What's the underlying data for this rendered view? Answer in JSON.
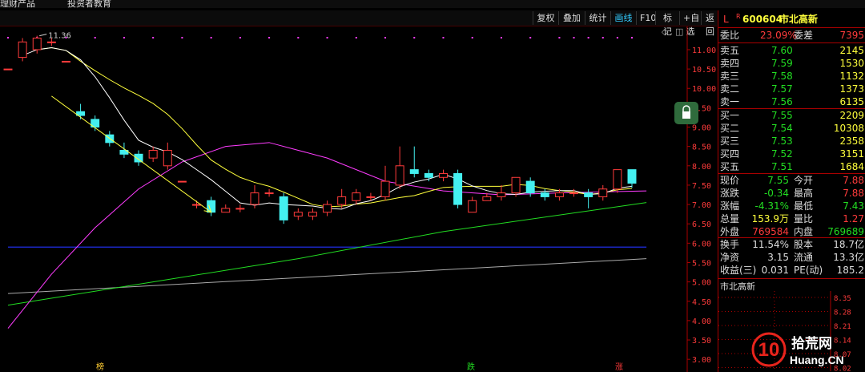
{
  "topbar": {
    "items": [
      "理财产品",
      "投资者教育"
    ]
  },
  "toolbar": {
    "buttons": [
      {
        "label": "复权",
        "active": false
      },
      {
        "label": "叠加",
        "active": false
      },
      {
        "label": "统计",
        "active": false
      },
      {
        "label": "画线",
        "active": true
      },
      {
        "label": "F10",
        "active": false
      },
      {
        "label": "标记",
        "active": false
      },
      {
        "label": "+自选",
        "active": false
      },
      {
        "label": "返回",
        "active": false
      }
    ]
  },
  "chart": {
    "peak_label": "11.36",
    "y_ticks": [
      "11.00",
      "10.50",
      "10.00",
      "9.50",
      "9.00",
      "8.50",
      "8.00",
      "7.50",
      "7.00",
      "6.50",
      "6.00",
      "5.50",
      "5.00",
      "4.50",
      "4.00",
      "3.50",
      "3.00"
    ],
    "bottom_markers": [
      {
        "label": "榜",
        "color": "#ffcc33"
      },
      {
        "label": "跌",
        "color": "#22dd22"
      },
      {
        "label": "涨",
        "color": "#ff3b3b"
      }
    ],
    "colors": {
      "up": "#ff3b3b",
      "down": "#44f0f0",
      "ma5": "#ffffff",
      "ma10": "#ffff3c",
      "ma20": "#ff3cff",
      "ma60": "#22dd22",
      "ma120": "#2233ff",
      "ma250": "#aaaaaa"
    }
  },
  "chart_data": {
    "type": "candlestick",
    "ylim": [
      2.9,
      11.6
    ],
    "candles": [
      {
        "o": 10.5,
        "c": 10.5,
        "h": 10.5,
        "l": 10.5
      },
      {
        "o": 10.8,
        "c": 11.2,
        "h": 11.3,
        "l": 10.7
      },
      {
        "o": 11.0,
        "c": 11.3,
        "h": 11.36,
        "l": 10.9
      },
      {
        "o": 11.2,
        "c": 11.2,
        "h": 11.3,
        "l": 11.1
      },
      {
        "o": 10.7,
        "c": 10.7,
        "h": 10.7,
        "l": 10.7
      },
      {
        "o": 9.4,
        "c": 9.3,
        "h": 9.6,
        "l": 9.2
      },
      {
        "o": 9.2,
        "c": 9.0,
        "h": 9.3,
        "l": 8.9
      },
      {
        "o": 8.8,
        "c": 8.6,
        "h": 8.9,
        "l": 8.5
      },
      {
        "o": 8.4,
        "c": 8.3,
        "h": 8.6,
        "l": 8.2
      },
      {
        "o": 8.3,
        "c": 8.1,
        "h": 8.4,
        "l": 8.0
      },
      {
        "o": 8.2,
        "c": 8.4,
        "h": 8.5,
        "l": 8.1
      },
      {
        "o": 8.0,
        "c": 8.4,
        "h": 8.6,
        "l": 7.9
      },
      {
        "o": 7.6,
        "c": 7.6,
        "h": 7.6,
        "l": 7.6
      },
      {
        "o": 7.0,
        "c": 7.0,
        "h": 7.1,
        "l": 6.9
      },
      {
        "o": 7.1,
        "c": 6.8,
        "h": 7.2,
        "l": 6.7
      },
      {
        "o": 6.8,
        "c": 6.9,
        "h": 7.0,
        "l": 6.8
      },
      {
        "o": 6.9,
        "c": 6.9,
        "h": 7.0,
        "l": 6.8
      },
      {
        "o": 7.0,
        "c": 7.3,
        "h": 7.5,
        "l": 6.9
      },
      {
        "o": 7.3,
        "c": 7.3,
        "h": 7.4,
        "l": 7.2
      },
      {
        "o": 7.2,
        "c": 6.6,
        "h": 7.3,
        "l": 6.5
      },
      {
        "o": 6.7,
        "c": 6.8,
        "h": 6.9,
        "l": 6.6
      },
      {
        "o": 6.7,
        "c": 6.8,
        "h": 6.9,
        "l": 6.6
      },
      {
        "o": 6.8,
        "c": 7.0,
        "h": 7.1,
        "l": 6.7
      },
      {
        "o": 7.0,
        "c": 7.2,
        "h": 7.4,
        "l": 6.9
      },
      {
        "o": 7.1,
        "c": 7.3,
        "h": 7.4,
        "l": 7.0
      },
      {
        "o": 7.2,
        "c": 7.2,
        "h": 7.3,
        "l": 7.1
      },
      {
        "o": 7.2,
        "c": 7.6,
        "h": 8.0,
        "l": 7.1
      },
      {
        "o": 7.5,
        "c": 8.0,
        "h": 8.5,
        "l": 7.4
      },
      {
        "o": 7.9,
        "c": 7.8,
        "h": 8.5,
        "l": 7.7
      },
      {
        "o": 7.8,
        "c": 7.7,
        "h": 7.9,
        "l": 7.6
      },
      {
        "o": 7.7,
        "c": 7.8,
        "h": 7.9,
        "l": 7.6
      },
      {
        "o": 7.8,
        "c": 7.0,
        "h": 7.9,
        "l": 6.9
      },
      {
        "o": 6.8,
        "c": 7.1,
        "h": 7.2,
        "l": 6.8
      },
      {
        "o": 7.1,
        "c": 7.2,
        "h": 7.3,
        "l": 7.1
      },
      {
        "o": 7.2,
        "c": 7.3,
        "h": 7.5,
        "l": 7.1
      },
      {
        "o": 7.3,
        "c": 7.7,
        "h": 7.7,
        "l": 7.2
      },
      {
        "o": 7.6,
        "c": 7.3,
        "h": 7.7,
        "l": 7.2
      },
      {
        "o": 7.3,
        "c": 7.2,
        "h": 7.4,
        "l": 7.1
      },
      {
        "o": 7.2,
        "c": 7.3,
        "h": 7.4,
        "l": 7.1
      },
      {
        "o": 7.3,
        "c": 7.3,
        "h": 7.4,
        "l": 7.2
      },
      {
        "o": 7.3,
        "c": 7.2,
        "h": 7.4,
        "l": 6.9
      },
      {
        "o": 7.2,
        "c": 7.4,
        "h": 7.5,
        "l": 7.1
      },
      {
        "o": 7.4,
        "c": 7.9,
        "h": 7.9,
        "l": 7.3
      },
      {
        "o": 7.9,
        "c": 7.55,
        "h": 7.9,
        "l": 7.43
      }
    ],
    "ma120": [
      [
        0,
        5.9
      ],
      [
        44,
        5.9
      ]
    ],
    "ma250": [
      [
        0,
        4.7
      ],
      [
        44,
        5.6
      ]
    ],
    "ma60": [
      [
        0,
        4.4
      ],
      [
        10,
        5.0
      ],
      [
        20,
        5.6
      ],
      [
        30,
        6.3
      ],
      [
        44,
        7.05
      ]
    ],
    "annotation_arrow": [
      [
        3,
        9.8
      ],
      [
        14,
        6.8
      ]
    ]
  },
  "quote": {
    "code": "600604",
    "name": "市北高新",
    "wei_bi_label": "委比",
    "wei_bi": "23.09%",
    "wei_cha_label": "委差",
    "wei_cha": "7395",
    "sell": [
      {
        "label": "卖五",
        "price": "7.60",
        "vol": "2145"
      },
      {
        "label": "卖四",
        "price": "7.59",
        "vol": "1530"
      },
      {
        "label": "卖三",
        "price": "7.58",
        "vol": "1132"
      },
      {
        "label": "卖二",
        "price": "7.57",
        "vol": "1373"
      },
      {
        "label": "卖一",
        "price": "7.56",
        "vol": "6135"
      }
    ],
    "buy": [
      {
        "label": "买一",
        "price": "7.55",
        "vol": "2209"
      },
      {
        "label": "买二",
        "price": "7.54",
        "vol": "10308"
      },
      {
        "label": "买三",
        "price": "7.53",
        "vol": "2358"
      },
      {
        "label": "买四",
        "price": "7.52",
        "vol": "3151"
      },
      {
        "label": "买五",
        "price": "7.51",
        "vol": "1684"
      }
    ],
    "stats": [
      [
        {
          "label": "现价",
          "value": "7.55",
          "color": "grn"
        },
        {
          "label": "今开",
          "value": "7.88",
          "color": "red"
        }
      ],
      [
        {
          "label": "涨跌",
          "value": "-0.34",
          "color": "grn"
        },
        {
          "label": "最高",
          "value": "7.88",
          "color": "red"
        }
      ],
      [
        {
          "label": "涨幅",
          "value": "-4.31%",
          "color": "grn"
        },
        {
          "label": "最低",
          "value": "7.43",
          "color": "grn"
        }
      ],
      [
        {
          "label": "总量",
          "value": "153.9万",
          "color": "yel"
        },
        {
          "label": "量比",
          "value": "1.27",
          "color": "red"
        }
      ],
      [
        {
          "label": "外盘",
          "value": "769584",
          "color": "red"
        },
        {
          "label": "内盘",
          "value": "769689",
          "color": "grn"
        }
      ]
    ],
    "stats2": [
      [
        {
          "label": "换手",
          "value": "11.54%"
        },
        {
          "label": "股本",
          "value": "18.7亿"
        }
      ],
      [
        {
          "label": "净资",
          "value": "3.15"
        },
        {
          "label": "流通",
          "value": "13.3亿"
        }
      ],
      [
        {
          "label": "收益(三)",
          "value": "0.031"
        },
        {
          "label": "PE(动)",
          "value": "185.2"
        }
      ]
    ]
  },
  "mini_chart": {
    "title": "市北高新",
    "y_ticks": [
      "8.35",
      "8.28",
      "8.21",
      "8.14",
      "8.07",
      "8.02"
    ]
  },
  "watermark": {
    "number": "10",
    "brand": "拾荒网",
    "domain": "Huang.CN"
  }
}
